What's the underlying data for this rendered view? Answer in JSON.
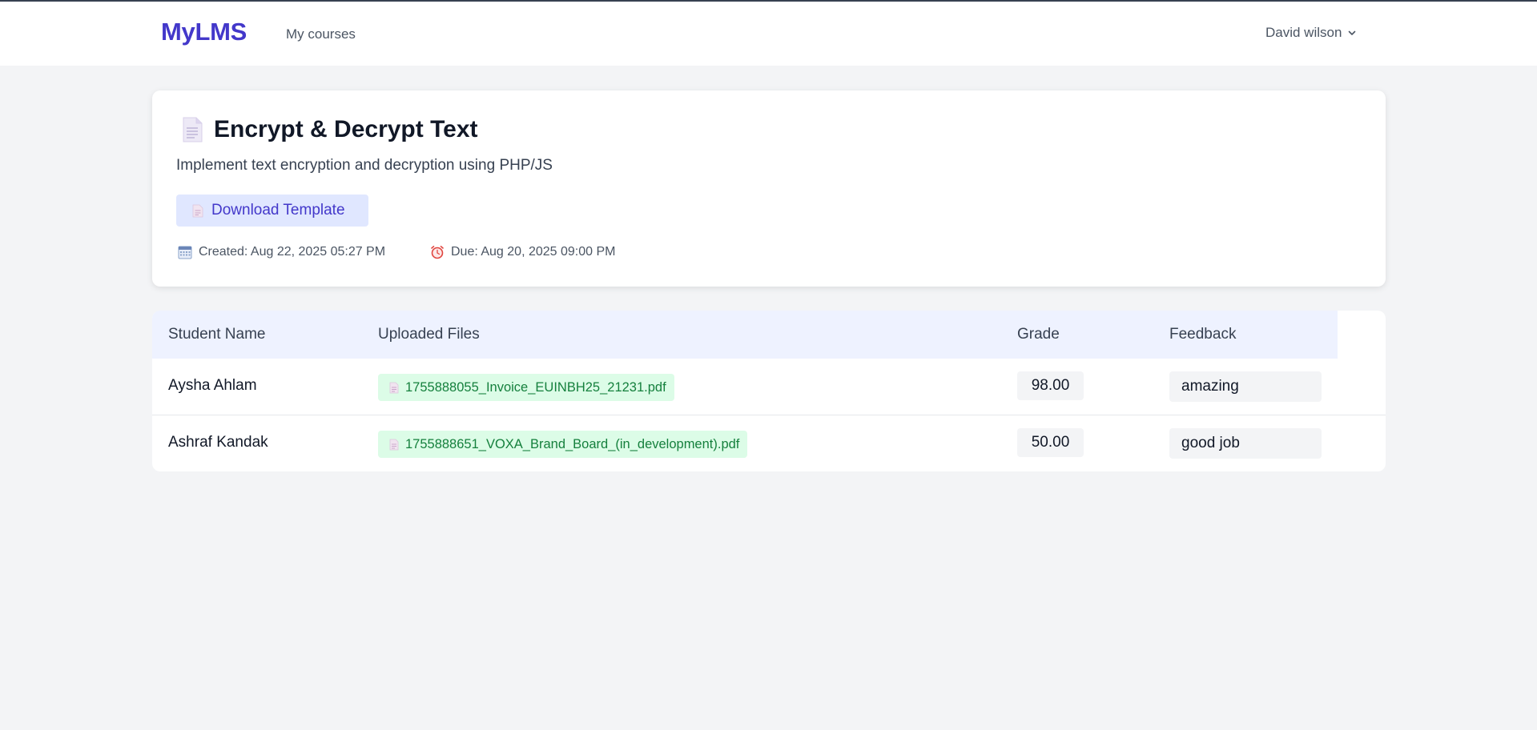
{
  "nav": {
    "brand": "MyLMS",
    "my_courses": "My courses",
    "user_name": "David wilson"
  },
  "assignment": {
    "title": "Encrypt & Decrypt Text",
    "description": "Implement text encryption and decryption using PHP/JS",
    "download_label": "Download Template",
    "created": "Created: Aug 22, 2025 05:27 PM",
    "due": "Due: Aug 20, 2025 09:00 PM"
  },
  "table": {
    "headers": {
      "student": "Student Name",
      "files": "Uploaded Files",
      "grade": "Grade",
      "feedback": "Feedback"
    },
    "rows": [
      {
        "student": "Aysha Ahlam",
        "file": "1755888055_Invoice_EUINBH25_21231.pdf",
        "grade": "98.00",
        "feedback": "amazing"
      },
      {
        "student": "Ashraf Kandak",
        "file": "1755888651_VOXA_Brand_Board_(in_development).pdf",
        "grade": "50.00",
        "feedback": "good job"
      }
    ]
  },
  "colors": {
    "brand": "#4338ca",
    "file_chip_bg": "#dcfce7",
    "file_chip_text": "#15803d",
    "header_bg": "#eef2ff"
  },
  "icons": {
    "title": "document-icon",
    "download": "document-icon",
    "created": "calendar-icon",
    "due": "alarm-clock-icon",
    "file": "document-icon",
    "user_menu": "chevron-down-icon"
  }
}
